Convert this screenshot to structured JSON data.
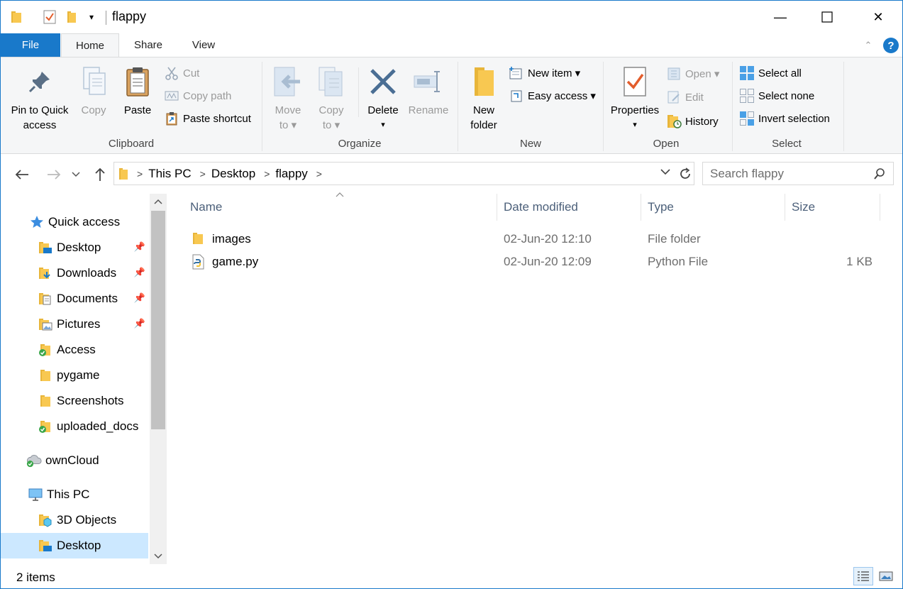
{
  "window": {
    "title": "flappy",
    "minimize_glyph": "—",
    "maximize_glyph": "☐",
    "close_glyph": "✕"
  },
  "tabs": {
    "file": "File",
    "home": "Home",
    "share": "Share",
    "view": "View"
  },
  "ribbon": {
    "clipboard": {
      "label": "Clipboard",
      "pin_line1": "Pin to Quick",
      "pin_line2": "access",
      "copy": "Copy",
      "paste": "Paste",
      "cut": "Cut",
      "copy_path": "Copy path",
      "paste_shortcut": "Paste shortcut"
    },
    "organize": {
      "label": "Organize",
      "move_line1": "Move",
      "move_line2": "to ▾",
      "copy_line1": "Copy",
      "copy_line2": "to ▾",
      "delete": "Delete",
      "delete_arrow": "▾",
      "rename": "Rename"
    },
    "new": {
      "label": "New",
      "new_folder_line1": "New",
      "new_folder_line2": "folder",
      "new_item": "New item ▾",
      "easy_access": "Easy access ▾"
    },
    "open": {
      "label": "Open",
      "properties": "Properties",
      "properties_arrow": "▾",
      "open": "Open ▾",
      "edit": "Edit",
      "history": "History"
    },
    "select": {
      "label": "Select",
      "select_all": "Select all",
      "select_none": "Select none",
      "invert_selection": "Invert selection"
    }
  },
  "address": {
    "crumbs": [
      "This PC",
      "Desktop",
      "flappy"
    ],
    "separator": ">",
    "search_placeholder": "Search flappy"
  },
  "navpane": {
    "items": [
      {
        "label": "Quick access",
        "icon": "star-icon"
      },
      {
        "label": "Desktop",
        "icon": "desktop-folder-icon",
        "pinned": true
      },
      {
        "label": "Downloads",
        "icon": "downloads-folder-icon",
        "pinned": true
      },
      {
        "label": "Documents",
        "icon": "documents-folder-icon",
        "pinned": true
      },
      {
        "label": "Pictures",
        "icon": "pictures-folder-icon",
        "pinned": true
      },
      {
        "label": "Access",
        "icon": "synced-folder-icon"
      },
      {
        "label": "pygame",
        "icon": "folder-icon"
      },
      {
        "label": "Screenshots",
        "icon": "folder-icon"
      },
      {
        "label": "uploaded_docs",
        "icon": "synced-folder-icon"
      },
      {
        "label": "ownCloud",
        "icon": "cloud-icon"
      },
      {
        "label": "This PC",
        "icon": "computer-icon"
      },
      {
        "label": "3D Objects",
        "icon": "3d-objects-icon"
      },
      {
        "label": "Desktop",
        "icon": "desktop-folder-icon"
      }
    ]
  },
  "filelist": {
    "columns": {
      "name": "Name",
      "date": "Date modified",
      "type": "Type",
      "size": "Size"
    },
    "rows": [
      {
        "name": "images",
        "date": "02-Jun-20 12:10",
        "type": "File folder",
        "size": "",
        "icon": "folder-icon"
      },
      {
        "name": "game.py",
        "date": "02-Jun-20 12:09",
        "type": "Python File",
        "size": "1 KB",
        "icon": "python-file-icon"
      }
    ]
  },
  "status": {
    "item_count": "2 items"
  },
  "colors": {
    "accent": "#1979ca",
    "folder": "#f8c851",
    "selected": "#cce8ff",
    "help": "#1979ca"
  }
}
